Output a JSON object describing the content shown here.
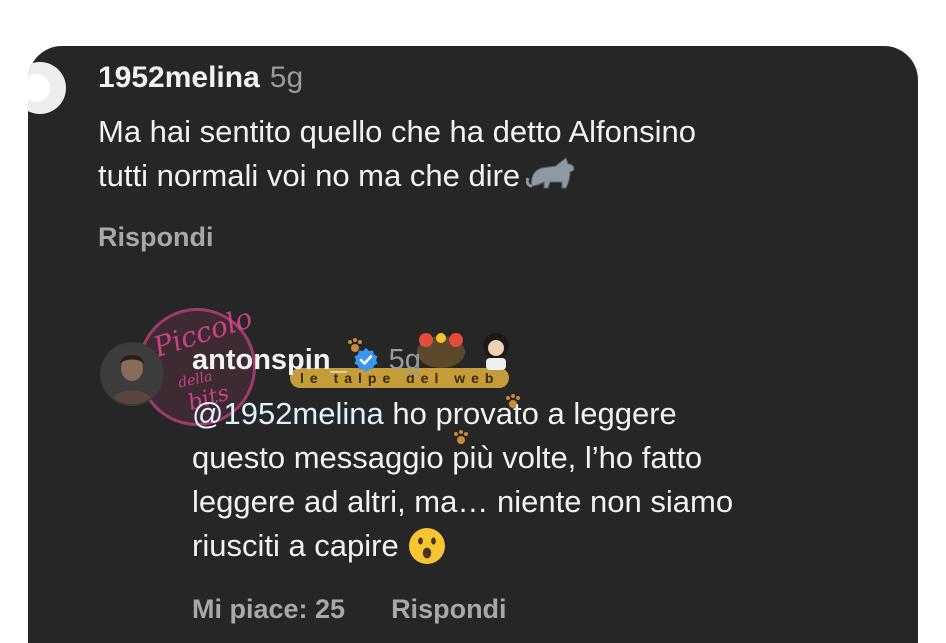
{
  "comment_1": {
    "username": "1952melina",
    "time": "5g",
    "text_line_1": "Ma hai sentito quello che ha detto Alfonsino",
    "text_line_2": "tutti normali voi no ma che dire",
    "emoji": "cat-icon",
    "reply_label": "Rispondi"
  },
  "comment_2": {
    "username": "antonspin_",
    "verified_icon": "verified-badge-icon",
    "time": "5g",
    "mention": "@1952melina",
    "text_line_1": " ho provato a leggere",
    "text_line_2": "questo messaggio più volte, l’ho fatto",
    "text_line_3": "leggere ad altri, ma… niente non siamo",
    "text_line_4": "riusciti a capire",
    "emoji": "surprised-face-icon",
    "likes_label": "Mi piace: 25",
    "reply_label": "Rispondi"
  },
  "watermark": {
    "logo_line_1": "Piccolo",
    "logo_line_2": "della",
    "logo_line_3": "bits",
    "banner": "le talpe del web"
  },
  "colors": {
    "card_background": "#262626",
    "primary_text": "#f2f2f2",
    "secondary_text": "#a8a8a8",
    "verified_blue": "#3897f0"
  }
}
